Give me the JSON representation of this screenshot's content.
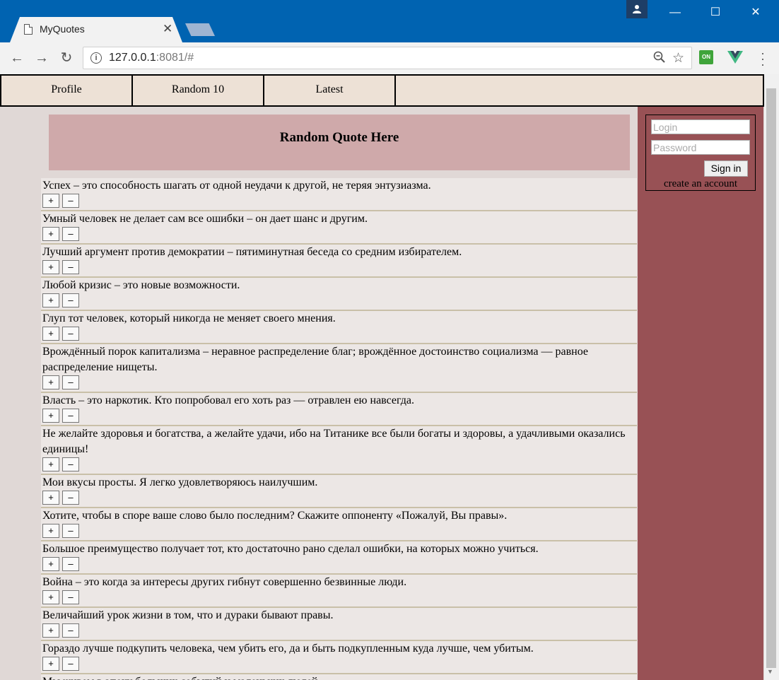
{
  "browser": {
    "tab_title": "MyQuotes",
    "tab_close": "✕",
    "url_host": "127.0.0.1",
    "url_rest": ":8081/#",
    "ext_on_label": "ON",
    "win_minimize": "—",
    "win_maximize": "☐",
    "win_close": "✕"
  },
  "nav": {
    "items": [
      "Profile",
      "Random 10",
      "Latest"
    ]
  },
  "banner": {
    "text": "Random Quote Here"
  },
  "login": {
    "login_placeholder": "Login",
    "password_placeholder": "Password",
    "signin_label": "Sign in",
    "create_label": "create an account"
  },
  "vote": {
    "plus": "+",
    "minus": "–"
  },
  "quotes": [
    "Успех – это способность шагать от одной неудачи к другой, не теряя энтузиазма.",
    "Умный человек не делает сам все ошибки – он дает шанс и другим.",
    "Лучший аргумент против демократии – пятиминутная беседа со средним избирателем.",
    "Любой кризис – это новые возможности.",
    "Глуп тот человек, который никогда не меняет своего мнения.",
    "Врождённый порок капитализма – неравное распределение благ; врождённое достоинство социализма — равное распределение нищеты.",
    "Власть – это наркотик. Кто попробовал его хоть раз — отравлен ею навсегда.",
    "Не желайте здоровья и богатства, а желайте удачи, ибо на Титанике все были богаты и здоровы, а удачливыми оказались единицы!",
    "Мои вкусы просты. Я легко удовлетворяюсь наилучшим.",
    "Хотите, чтобы в споре ваше слово было последним? Скажите оппоненту «Пожалуй, Вы правы».",
    "Большое преимущество получает тот, кто достаточно рано сделал ошибки, на которых можно учиться.",
    "Война – это когда за интересы других гибнут совершенно безвинные люди.",
    "Величайший урок жизни в том, что и дураки бывают правы.",
    "Гораздо лучше подкупить человека, чем убить его, да и быть подкупленным куда лучше, чем убитым.",
    "Мы живем в эпоху больших событий и маленьких людей."
  ]
}
